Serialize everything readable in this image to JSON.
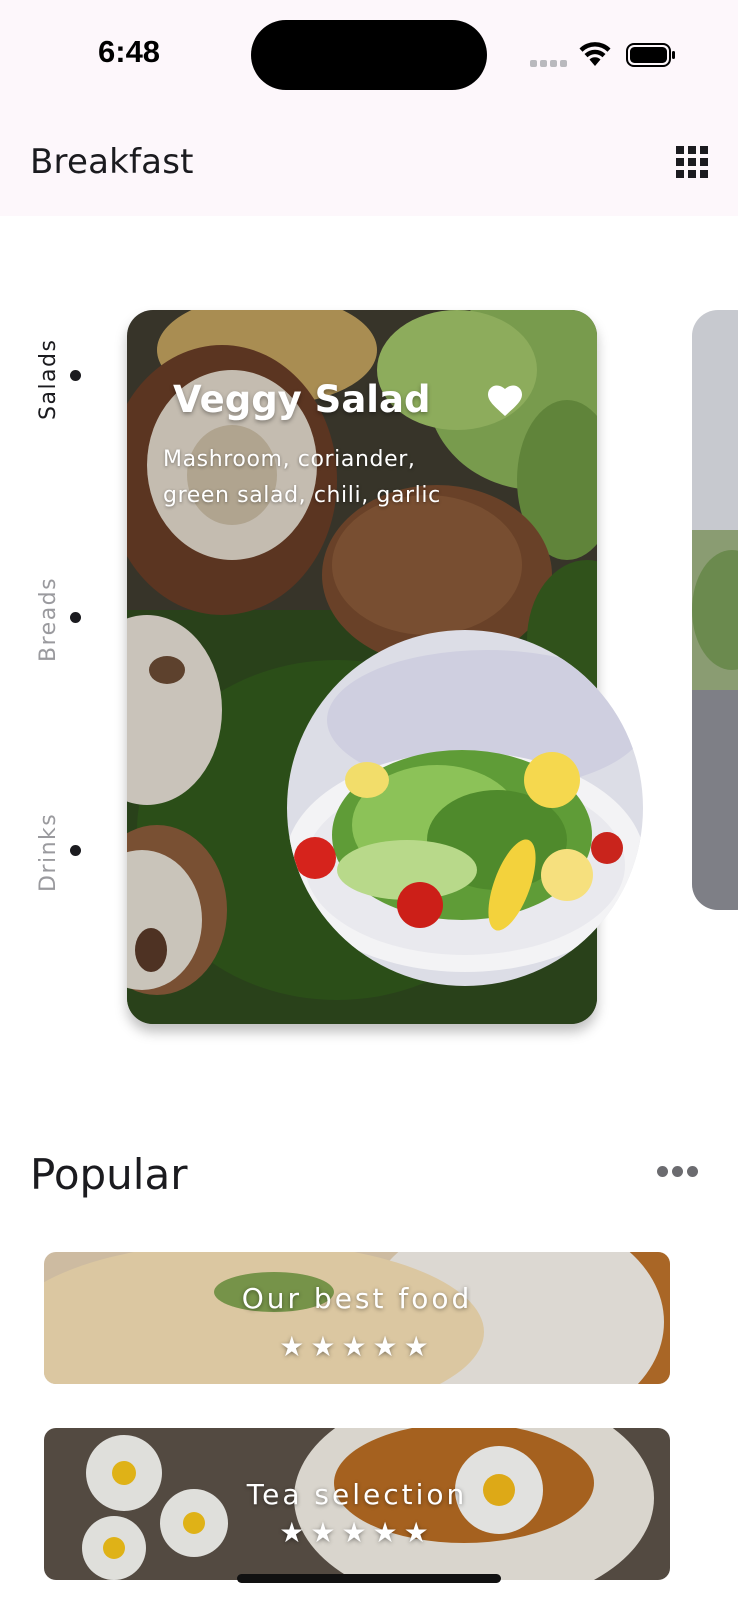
{
  "status_bar": {
    "time": "6:48",
    "icons": [
      "cellular-icon",
      "wifi-icon",
      "battery-icon"
    ]
  },
  "app_bar": {
    "title": "Breakfast",
    "menu_icon": "grid-icon"
  },
  "categories": [
    {
      "label": "Salads",
      "selected": true
    },
    {
      "label": "Breads",
      "selected": false
    },
    {
      "label": "Drinks",
      "selected": false
    }
  ],
  "featured": {
    "title": "Veggy Salad",
    "description": "Mashroom, coriander, green salad, chili, garlic",
    "favorite_icon": "heart-icon"
  },
  "popular": {
    "title": "Popular",
    "more_icon": "more-horizontal-icon",
    "items": [
      {
        "title": "Our best food",
        "stars": "★★★★★",
        "rating": 5
      },
      {
        "title": "Tea selection",
        "stars": "★★★★★",
        "rating": 5
      }
    ]
  },
  "colors": {
    "text": "#1b1b1f",
    "muted": "#9a9a9e",
    "surface": "#fdf7fb"
  }
}
